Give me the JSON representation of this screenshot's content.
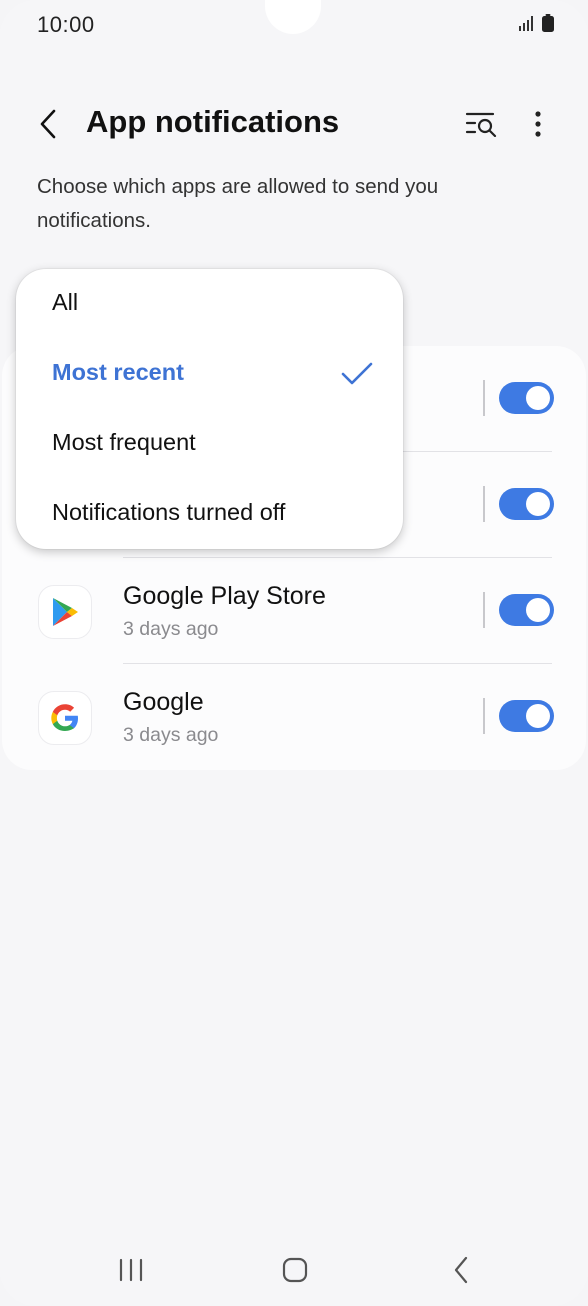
{
  "status_bar": {
    "time": "10:00",
    "icons": [
      "signal-icon",
      "battery-icon"
    ]
  },
  "header": {
    "title": "App notifications",
    "back_icon": "chevron-left-icon",
    "search_icon": "filter-search-icon",
    "more_icon": "more-vertical-icon"
  },
  "description": "Choose which apps are allowed to send you notifications.",
  "apps": [
    {
      "name": "",
      "time": "",
      "enabled": true
    },
    {
      "name": "",
      "time": "",
      "enabled": true
    },
    {
      "name": "Google Play Store",
      "time": "3 days ago",
      "enabled": true,
      "icon": "google-play-icon"
    },
    {
      "name": "Google",
      "time": "3 days ago",
      "enabled": true,
      "icon": "google-icon"
    }
  ],
  "dropdown": {
    "items": [
      {
        "label": "All",
        "selected": false
      },
      {
        "label": "Most recent",
        "selected": true
      },
      {
        "label": "Most frequent",
        "selected": false
      },
      {
        "label": "Notifications turned off",
        "selected": false
      }
    ]
  },
  "colors": {
    "accent": "#3e7ae3",
    "selected_text": "#3e73d4",
    "background": "#f6f6f8"
  },
  "nav_bar": {
    "icons": [
      "recents-icon",
      "home-icon",
      "back-icon"
    ]
  }
}
